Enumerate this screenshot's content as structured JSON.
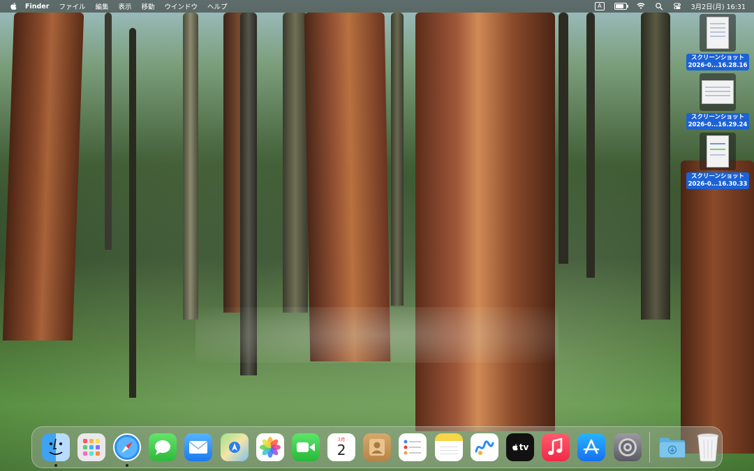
{
  "menubar": {
    "app_name": "Finder",
    "menus": [
      "ファイル",
      "編集",
      "表示",
      "移動",
      "ウインドウ",
      "ヘルプ"
    ],
    "input_source": "A",
    "battery_level": 0.85,
    "datetime": "3月2日(月)  16:31"
  },
  "desktop": {
    "items": [
      {
        "label_line1": "スクリーンショット",
        "label_line2": "2026-0...16.28.16"
      },
      {
        "label_line1": "スクリーンショット",
        "label_line2": "2026-0...16.29.24"
      },
      {
        "label_line1": "スクリーンショット",
        "label_line2": "2026-0...16.30.33"
      }
    ]
  },
  "dock": {
    "calendar_month": "3月",
    "calendar_day": "2",
    "tv_label": "tv",
    "apps": [
      "finder",
      "launchpad",
      "safari",
      "messages",
      "mail",
      "maps",
      "photos",
      "facetime",
      "calendar",
      "contacts",
      "reminders",
      "notes",
      "freeform",
      "tv",
      "music",
      "app-store",
      "system-settings",
      "downloads",
      "trash"
    ]
  },
  "colors": {
    "selection_blue": "#1c62d6",
    "menubar_bg": "#28281f"
  }
}
